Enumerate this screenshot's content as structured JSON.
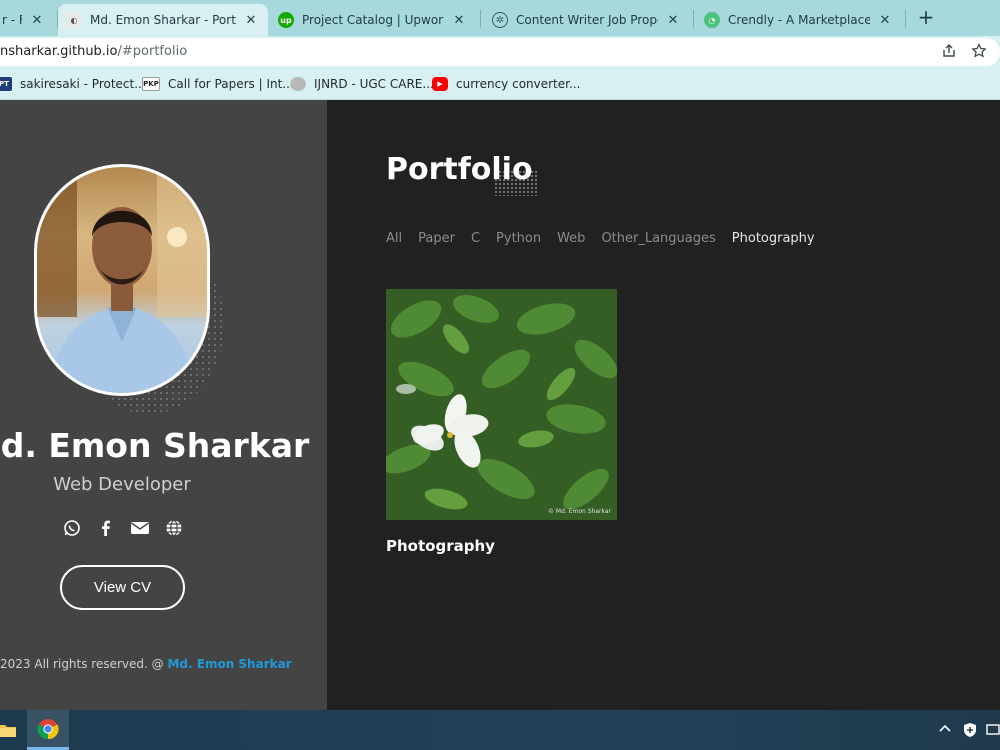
{
  "browser": {
    "tabs": [
      {
        "title": "r - Fu",
        "favicon": "generic"
      },
      {
        "title": "Md. Emon Sharkar - Portfolio",
        "favicon": "portfolio-favicon",
        "active": true
      },
      {
        "title": "Project Catalog | Upwork",
        "favicon": "upwork-logo",
        "favicon_text": "up"
      },
      {
        "title": "Content Writer Job Proposal.",
        "favicon": "chatgpt-logo"
      },
      {
        "title": "Crendly - A Marketplace for",
        "favicon": "crendly-logo"
      }
    ],
    "close_glyph": "✕",
    "new_tab_glyph": "+",
    "url_host": "nsharkar.github.io",
    "url_path": "/#portfolio",
    "bookmarks": [
      {
        "label": "sakiresaki - Protect...",
        "icon_text": "PT"
      },
      {
        "label": "Call for Papers | Int...",
        "icon_text": "PKP"
      },
      {
        "label": "IJNRD - UGC CARE...",
        "icon_text": ""
      },
      {
        "label": "currency converter...",
        "icon_text": "▶"
      }
    ]
  },
  "sidebar": {
    "name": "d. Emon Sharkar",
    "role": "Web Developer",
    "socials": [
      "whatsapp-icon",
      "facebook-icon",
      "email-icon",
      "globe-icon"
    ],
    "view_cv_label": "View CV",
    "copyright_prefix": "2023 All rights reserved. @ ",
    "copyright_author": "Md. Emon Sharkar",
    "author_color": "#1f9ad9"
  },
  "portfolio": {
    "title": "Portfolio",
    "filters": [
      "All",
      "Paper",
      "C",
      "Python",
      "Web",
      "Other_Languages",
      "Photography"
    ],
    "active_filter": "Photography",
    "item": {
      "caption": "Photography",
      "watermark": "© Md. Emon Sharkar"
    }
  },
  "colors": {
    "sidebar_bg": "#444444",
    "main_bg": "#212121",
    "tab_strip": "#a7d8dc",
    "accent": "#1f9ad9"
  }
}
